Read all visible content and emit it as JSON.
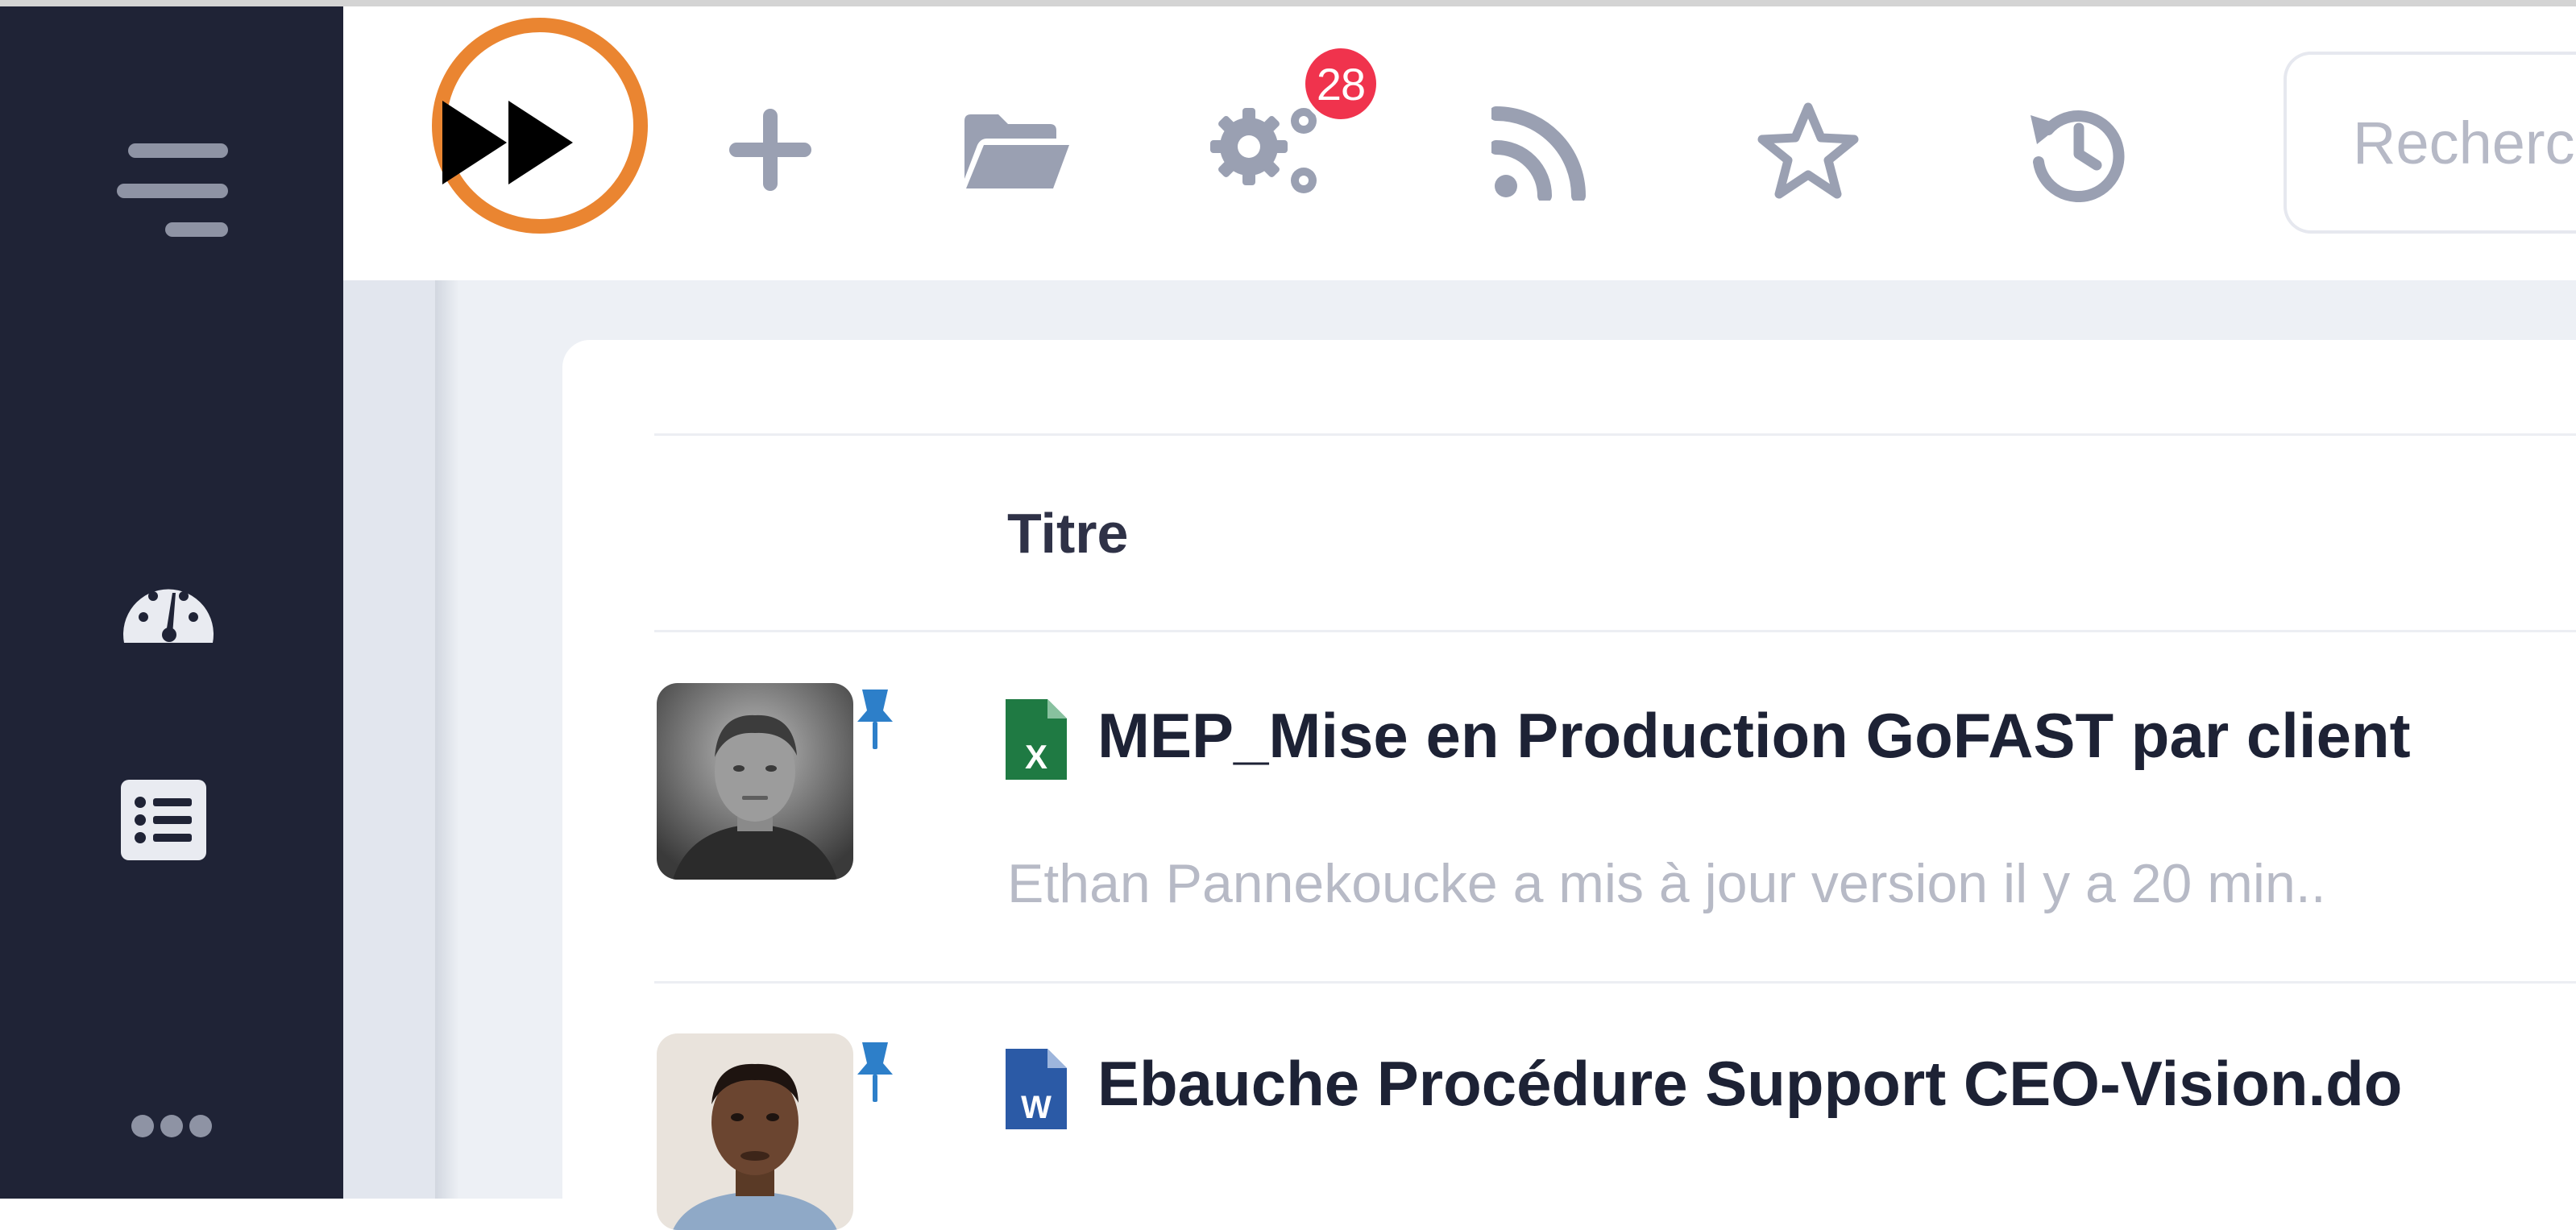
{
  "toolbar": {
    "forward_glyph": "▶▶",
    "notification_count": "28",
    "search_placeholder": "Recherche",
    "icons": [
      "fast-forward-icon",
      "plus-icon",
      "folder-open-icon",
      "gears-icon",
      "rss-icon",
      "star-icon",
      "history-icon"
    ]
  },
  "sidebar": {
    "icons": [
      "menu-icon",
      "dashboard-gauge-icon",
      "list-icon",
      "more-icon"
    ]
  },
  "table": {
    "header_title": "Titre",
    "rows": [
      {
        "file_type": "excel",
        "file_letter": "X",
        "title": "MEP_Mise en Production GoFAST par client",
        "subtitle": "Ethan Pannekoucke a mis à jour version il y a 20 min..",
        "pinned": true
      },
      {
        "file_type": "word",
        "file_letter": "W",
        "title": "Ebauche Procédure Support CEO-Vision.do",
        "pinned": true
      }
    ]
  },
  "colors": {
    "sidebar_bg": "#1f2336",
    "highlight_ring": "#ea8531",
    "badge": "#f0334d",
    "excel_green": "#1f7a43",
    "word_blue": "#2b5aa6",
    "pin_blue": "#2d7fc9"
  }
}
